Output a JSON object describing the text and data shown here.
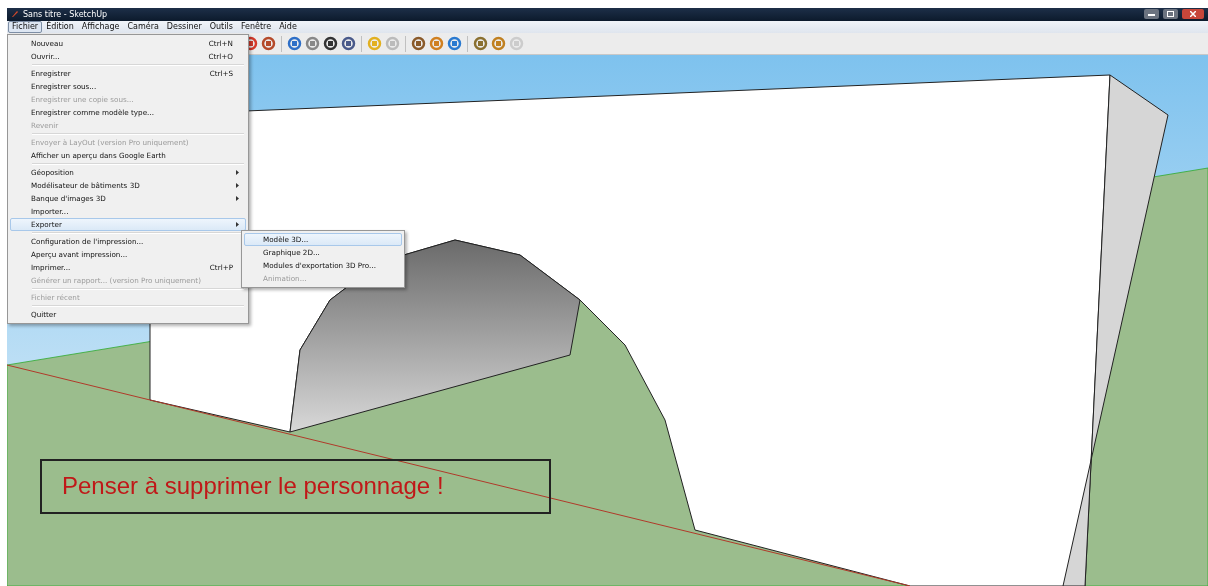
{
  "window": {
    "title": "Sans titre - SketchUp"
  },
  "menu_bar": [
    {
      "label": "Fichier",
      "selected": true
    },
    {
      "label": "Édition",
      "selected": false
    },
    {
      "label": "Affichage",
      "selected": false
    },
    {
      "label": "Caméra",
      "selected": false
    },
    {
      "label": "Dessiner",
      "selected": false
    },
    {
      "label": "Outils",
      "selected": false
    },
    {
      "label": "Fenêtre",
      "selected": false
    },
    {
      "label": "Aide",
      "selected": false
    }
  ],
  "file_menu": [
    [
      {
        "label": "Nouveau",
        "shortcut": "Ctrl+N",
        "disabled": false,
        "submenu": false,
        "selected": false
      },
      {
        "label": "Ouvrir...",
        "shortcut": "Ctrl+O",
        "disabled": false,
        "submenu": false,
        "selected": false
      }
    ],
    [
      {
        "label": "Enregistrer",
        "shortcut": "Ctrl+S",
        "disabled": false,
        "submenu": false,
        "selected": false
      },
      {
        "label": "Enregistrer sous...",
        "disabled": false,
        "submenu": false,
        "selected": false
      },
      {
        "label": "Enregistrer une copie sous...",
        "disabled": true,
        "submenu": false,
        "selected": false
      },
      {
        "label": "Enregistrer comme modèle type...",
        "disabled": false,
        "submenu": false,
        "selected": false
      },
      {
        "label": "Revenir",
        "disabled": true,
        "submenu": false,
        "selected": false
      }
    ],
    [
      {
        "label": "Envoyer à LayOut (version Pro uniquement)",
        "disabled": true,
        "submenu": false,
        "selected": false
      },
      {
        "label": "Afficher un aperçu dans Google Earth",
        "disabled": false,
        "submenu": false,
        "selected": false
      }
    ],
    [
      {
        "label": "Géoposition",
        "disabled": false,
        "submenu": true,
        "selected": false
      },
      {
        "label": "Modélisateur de bâtiments 3D",
        "disabled": false,
        "submenu": true,
        "selected": false
      },
      {
        "label": "Banque d'images 3D",
        "disabled": false,
        "submenu": true,
        "selected": false
      },
      {
        "label": "Importer...",
        "disabled": false,
        "submenu": false,
        "selected": false
      },
      {
        "label": "Exporter",
        "disabled": false,
        "submenu": true,
        "selected": true
      }
    ],
    [
      {
        "label": "Configuration de l'impression...",
        "disabled": false,
        "submenu": false,
        "selected": false
      },
      {
        "label": "Aperçu avant impression...",
        "disabled": false,
        "submenu": false,
        "selected": false
      },
      {
        "label": "Imprimer...",
        "shortcut": "Ctrl+P",
        "disabled": false,
        "submenu": false,
        "selected": false
      },
      {
        "label": "Générer un rapport... (version Pro uniquement)",
        "disabled": true,
        "submenu": false,
        "selected": false
      }
    ],
    [
      {
        "label": "Fichier récent",
        "disabled": true,
        "submenu": false,
        "selected": false
      }
    ],
    [
      {
        "label": "Quitter",
        "disabled": false,
        "submenu": false,
        "selected": false
      }
    ]
  ],
  "export_submenu": [
    {
      "label": "Modèle 3D...",
      "disabled": false,
      "selected": true
    },
    {
      "label": "Graphique 2D...",
      "disabled": false,
      "selected": false
    },
    {
      "label": "Modules d'exportation 3D Pro...",
      "disabled": false,
      "selected": false
    },
    {
      "label": "Animation...",
      "disabled": true,
      "selected": false
    }
  ],
  "annotation": {
    "text": "Penser à supprimer le personnage !"
  }
}
